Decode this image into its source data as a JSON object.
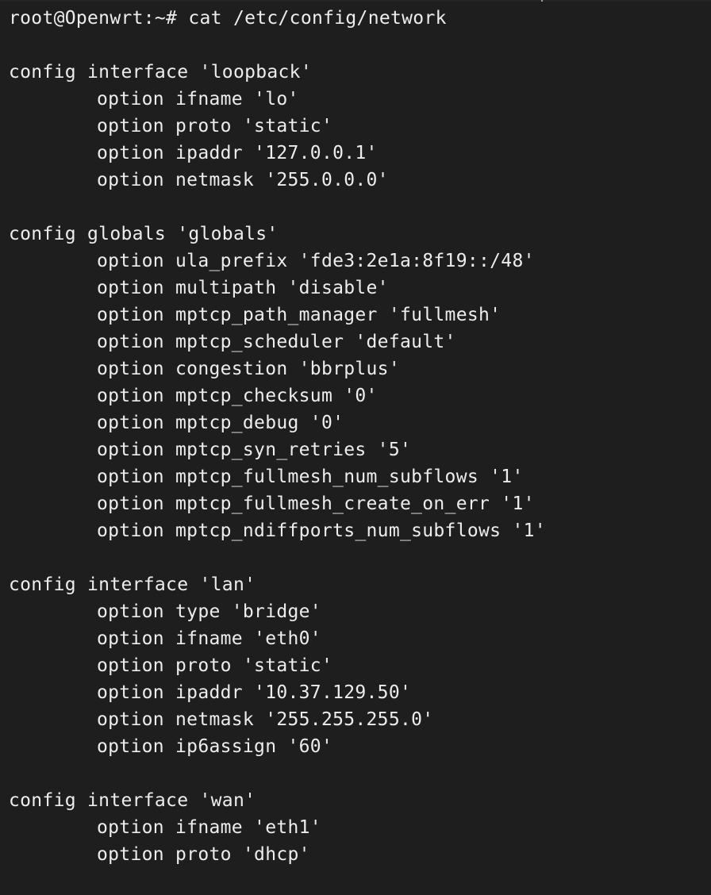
{
  "terminal": {
    "prompt": "root@Openwrt:~# cat /etc/config/network",
    "lines": [
      "config interface 'loopback'",
      "option ifname 'lo'",
      "option proto 'static'",
      "option ipaddr '127.0.0.1'",
      "option netmask '255.0.0.0'",
      "config globals 'globals'",
      "option ula_prefix 'fde3:2e1a:8f19::/48'",
      "option multipath 'disable'",
      "option mptcp_path_manager 'fullmesh'",
      "option mptcp_scheduler 'default'",
      "option congestion 'bbrplus'",
      "option mptcp_checksum '0'",
      "option mptcp_debug '0'",
      "option mptcp_syn_retries '5'",
      "option mptcp_fullmesh_num_subflows '1'",
      "option mptcp_fullmesh_create_on_err '1'",
      "option mptcp_ndiffports_num_subflows '1'",
      "config interface 'lan'",
      "option type 'bridge'",
      "option ifname 'eth0'",
      "option proto 'static'",
      "option ipaddr '10.37.129.50'",
      "option netmask '255.255.255.0'",
      "option ip6assign '60'",
      "config interface 'wan'",
      "option ifname 'eth1'",
      "option proto 'dhcp'"
    ]
  },
  "colors": {
    "background": "#1e1e1e",
    "foreground": "#ededed"
  }
}
